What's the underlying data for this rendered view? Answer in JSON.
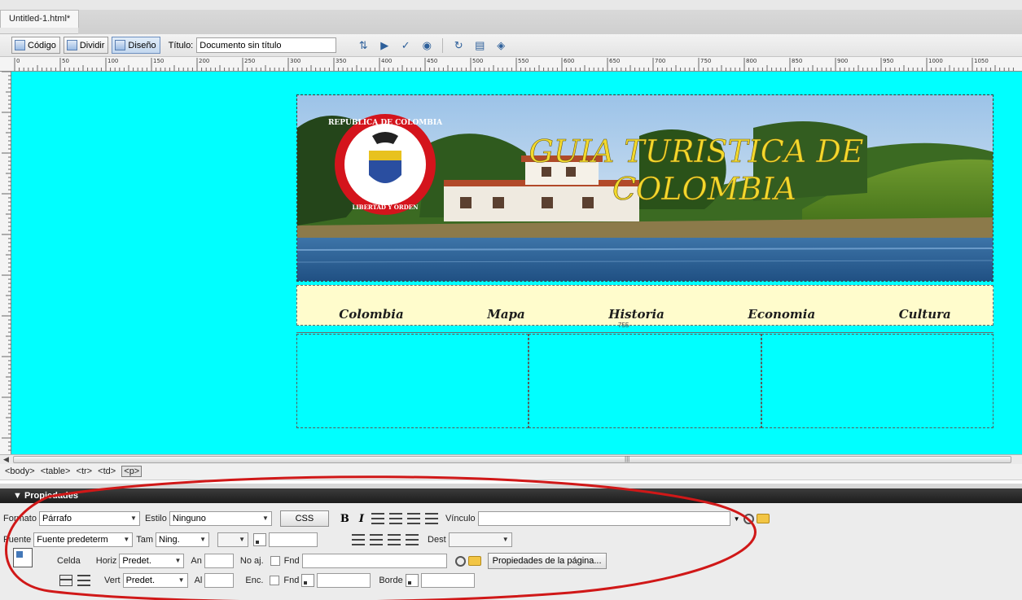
{
  "window": {
    "tab_title": "Untitled-1.html*"
  },
  "toolbar": {
    "code_label": "Código",
    "split_label": "Dividir",
    "design_label": "Diseño",
    "title_label": "Título:",
    "title_value": "Documento sin título"
  },
  "ruler": {
    "marks": [
      "0",
      "50",
      "100",
      "150",
      "200",
      "250",
      "300",
      "350",
      "400",
      "450",
      "500",
      "550",
      "600",
      "650",
      "700",
      "750",
      "800",
      "850",
      "900",
      "950",
      "1000",
      "1050"
    ]
  },
  "page": {
    "canvas_color": "#00ffff",
    "banner": {
      "title_line1": "GUIA TURISTICA DE",
      "title_line2": "COLOMBIA",
      "seal_text_top": "REPUBLICA DE COLOMBIA",
      "seal_text_bottom": "LIBERTAD Y ORDEN"
    },
    "nav": [
      "Colombia",
      "Mapa",
      "Historia",
      "Economia",
      "Cultura"
    ],
    "table_width_label": "755"
  },
  "tag_selector": [
    "<body>",
    "<table>",
    "<tr>",
    "<td>",
    "<p>"
  ],
  "properties": {
    "panel_title": "▼ Propiedades",
    "format_label": "Formato",
    "format_value": "Párrafo",
    "style_label": "Estilo",
    "style_value": "Ninguno",
    "css_button": "CSS",
    "bold_button": "B",
    "italic_button": "I",
    "link_label": "Vínculo",
    "font_label": "Fuente",
    "font_value": "Fuente predeterm",
    "size_label": "Tam",
    "size_value": "Ning.",
    "target_label": "Dest",
    "cell_label": "Celda",
    "horz_label": "Horiz",
    "horz_value": "Predet.",
    "vert_label": "Vert",
    "vert_value": "Predet.",
    "width_label": "An",
    "height_label": "Al",
    "nowrap_label": "No aj.",
    "header_label": "Enc.",
    "bg_label": "Fnd",
    "border_label": "Borde",
    "page_props_button": "Propiedades de la página...",
    "annotation_color": "#d01818"
  }
}
